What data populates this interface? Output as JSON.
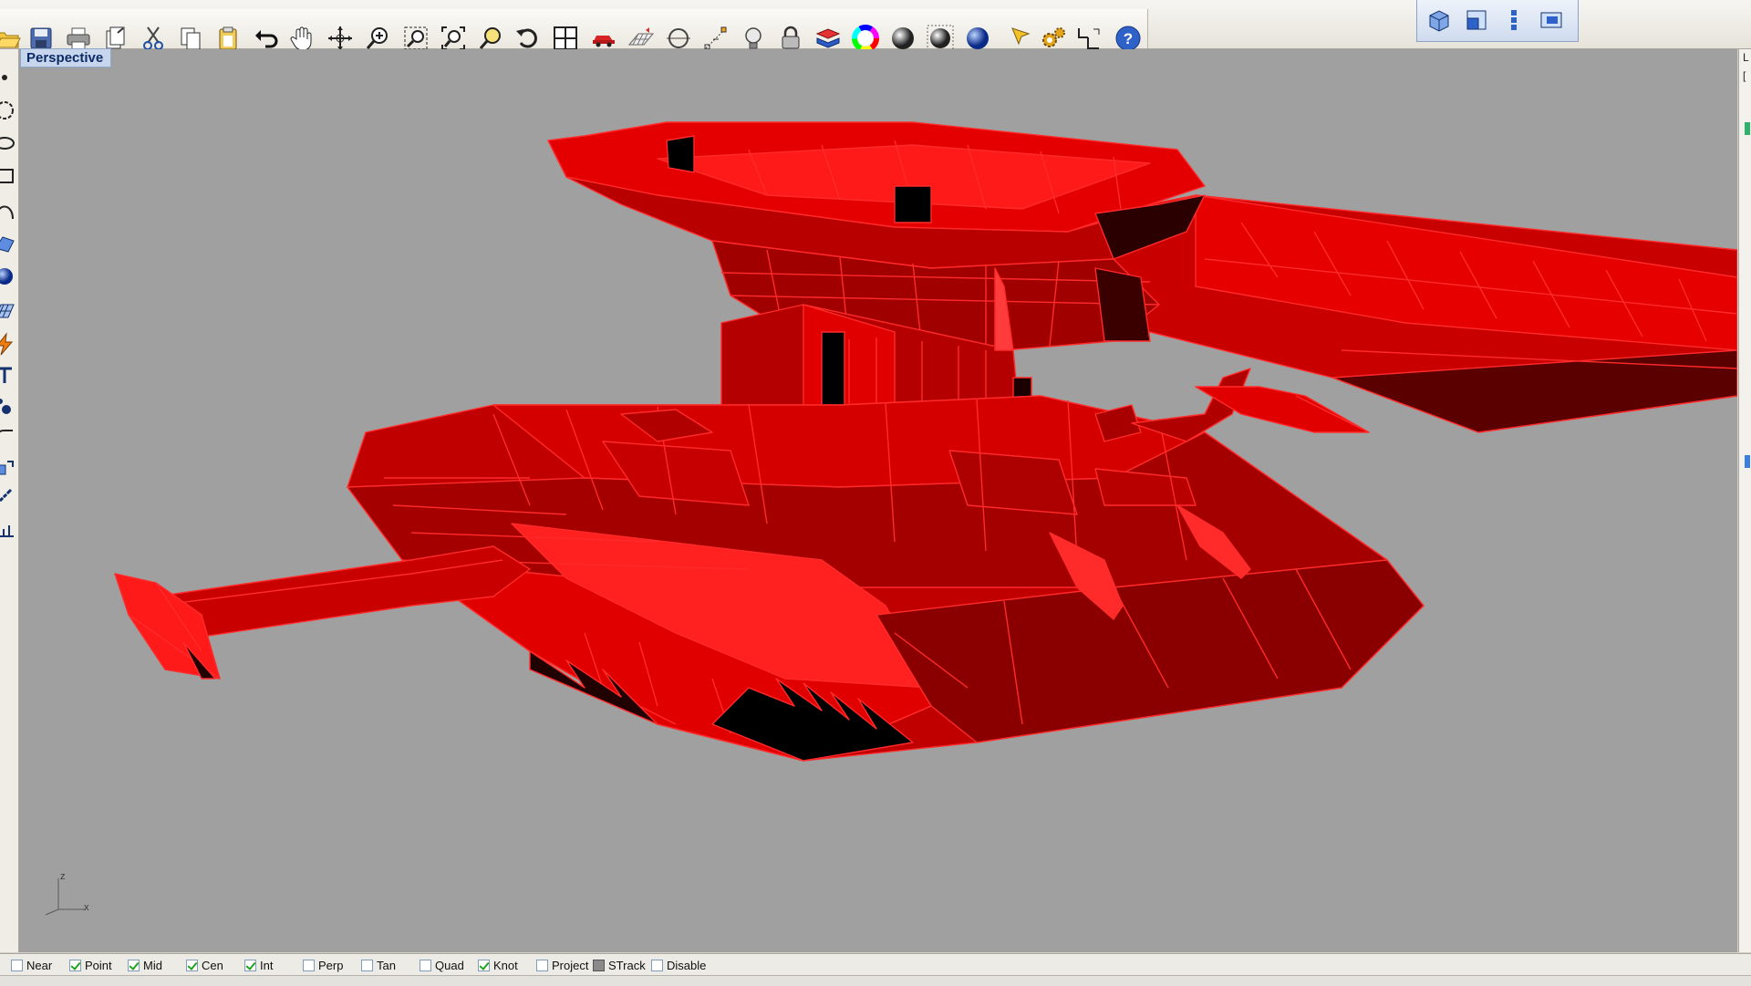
{
  "toolbar": {
    "main_icons": [
      "open-icon",
      "save-icon",
      "print-icon",
      "import-icon",
      "cut-icon",
      "copy-icon",
      "paste-icon",
      "undo-icon",
      "pan-hand-icon",
      "rotate-view-icon",
      "zoom-icon",
      "zoom-window-icon",
      "zoom-extents-icon",
      "zoom-selected-icon",
      "undo-view-icon",
      "four-viewports-icon",
      "car-icon",
      "grid-icon",
      "point-snap-icon",
      "transform-icon",
      "light-bulb-icon",
      "lock-icon",
      "layer-icon",
      "color-wheel-icon",
      "shaded-sphere-icon",
      "rendered-sphere-icon",
      "blue-sphere-icon",
      "select-arrow-icon",
      "settings-gear-icon",
      "dimension-icon",
      "help-icon"
    ],
    "view_icons": [
      "perspective-view-icon",
      "top-view-icon",
      "side-view-icon",
      "front-view-icon"
    ]
  },
  "left_toolbar": {
    "icons": [
      "point-icon",
      "circle-icon",
      "ellipse-icon",
      "rectangle-icon",
      "curve-icon",
      "surface-icon",
      "solid-sphere-icon",
      "mesh-icon",
      "lightning-icon",
      "text-icon",
      "dots-icon",
      "fillet-icon",
      "transform-icon",
      "dimension-icon",
      "ruler-icon"
    ]
  },
  "viewport": {
    "title": "Perspective",
    "background": "#a0a0a0",
    "model_color": "#e00000",
    "axes": {
      "z": "z",
      "x": "x"
    }
  },
  "right_panel": {
    "label_top": "L",
    "label_second": "["
  },
  "osnaps": [
    {
      "label": "Near",
      "checked": false
    },
    {
      "label": "Point",
      "checked": true
    },
    {
      "label": "Mid",
      "checked": true
    },
    {
      "label": "Cen",
      "checked": true
    },
    {
      "label": "Int",
      "checked": true
    },
    {
      "label": "Perp",
      "checked": false
    },
    {
      "label": "Tan",
      "checked": false
    },
    {
      "label": "Quad",
      "checked": false
    },
    {
      "label": "Knot",
      "checked": true
    },
    {
      "label": "Project",
      "checked": false
    },
    {
      "label": "STrack",
      "checked": false,
      "filled": true
    },
    {
      "label": "Disable",
      "checked": false
    }
  ]
}
